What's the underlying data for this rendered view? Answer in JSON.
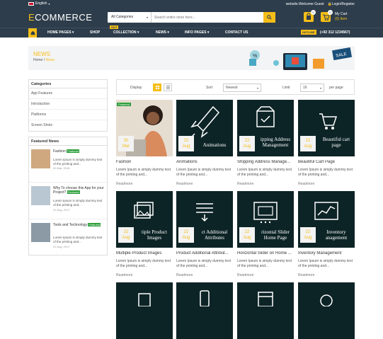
{
  "topbar": {
    "language": "English",
    "welcome": "website.Welcome Guest",
    "login": "Login/Register"
  },
  "header": {
    "logo_e": "E",
    "logo_rest": "COMMERCE",
    "search_category": "All Categories",
    "search_placeholder": "Search entire store here...",
    "wishlist_count": "0",
    "cart_count": "0",
    "cart_label": "My Cart",
    "cart_items": "(0) Item"
  },
  "nav": {
    "items": [
      "HOME PAGES",
      "SHOP",
      "COLLECTION",
      "NEWS",
      "INFO PAGES",
      "CONTACT US"
    ],
    "hot": "HOT",
    "hotline_label": "HOTLINE",
    "phone": "(+92 312 1234567)"
  },
  "banner": {
    "title": "NEWS",
    "crumb_home": "Home",
    "crumb_sep": "/",
    "crumb_current": "News",
    "sale": "SALE",
    "pct": "%"
  },
  "sidebar": {
    "categories_title": "Categories",
    "categories": [
      "App Features",
      "Introduction",
      "Platforms",
      "Screen Shots"
    ],
    "featured_title": "Featured News",
    "featured_badge": "Featured",
    "featured": [
      {
        "title": "Fashion",
        "desc": "Lorem Ipsum is simply dummy text of the printing and...",
        "date": "30 Mar, 2018"
      },
      {
        "title": "Why To choose this App for your Project?",
        "desc": "Lorem Ipsum is simply dummy text of the printing and...",
        "date": "22 Aug, 2017"
      },
      {
        "title": "Tools and Technology",
        "desc": "Lorem Ipsum is simply dummy text of the printing and...",
        "date": "22 Aug, 2017"
      }
    ]
  },
  "toolbar": {
    "display": "Display",
    "sort": "Sort",
    "sort_value": "Newest",
    "limit": "Limit",
    "limit_value": "16",
    "per_page": "per page"
  },
  "posts": [
    {
      "title": "Fashion",
      "day": "30",
      "month": "Mar",
      "featured": "Featured",
      "overlay": "",
      "desc": "Lorem Ipsum is simply dummy text of the printing and...",
      "readmore": "Readmore"
    },
    {
      "title": "Animations",
      "day": "22",
      "month": "Aug",
      "overlay": "Animations",
      "desc": "Lorem Ipsum is simply dummy text of the printing and...",
      "readmore": "Readmore"
    },
    {
      "title": "Shipping Address Manage...",
      "day": "22",
      "month": "Aug",
      "overlay": "ipping Address\nManagement",
      "desc": "Lorem Ipsum is simply dummy text of the printing and...",
      "readmore": "Readmore"
    },
    {
      "title": "Beautiful Cart Page",
      "day": "22",
      "month": "Aug",
      "overlay": "Beautiful cart\npage",
      "desc": "Lorem Ipsum is simply dummy text of the printing and...",
      "readmore": "Readmore"
    },
    {
      "title": "Multiple Product Images",
      "day": "22",
      "month": "Aug",
      "overlay": "tiple Product\nImages",
      "desc": "Lorem Ipsum is simply dummy text of the printing and...",
      "readmore": "Readmore"
    },
    {
      "title": "Product Additional Attribut...",
      "day": "22",
      "month": "Aug",
      "overlay": "ct Additional\nAttributes",
      "desc": "Lorem Ipsum is simply dummy text of the printing and...",
      "readmore": "Readmore"
    },
    {
      "title": "Horizontal Slider on Home ...",
      "day": "22",
      "month": "Aug",
      "overlay": "rizontal Slider\nHome Page",
      "desc": "Lorem Ipsum is simply dummy text of the printing and...",
      "readmore": "Readmore"
    },
    {
      "title": "Inventory Management",
      "day": "22",
      "month": "Aug",
      "overlay": "Inventory\nanagement",
      "desc": "Lorem Ipsum is simply dummy text of the printing and...",
      "readmore": "Readmore"
    },
    {
      "title": "",
      "day": "",
      "month": "",
      "overlay": "",
      "desc": "",
      "readmore": ""
    },
    {
      "title": "",
      "day": "",
      "month": "",
      "overlay": "",
      "desc": "",
      "readmore": ""
    },
    {
      "title": "",
      "day": "",
      "month": "",
      "overlay": "",
      "desc": "",
      "readmore": ""
    },
    {
      "title": "",
      "day": "",
      "month": "",
      "overlay": "",
      "desc": "",
      "readmore": ""
    }
  ],
  "colors": {
    "dark": "#2e3d4b",
    "accent": "#f6be18",
    "tile": "#0d2426",
    "featured": "#2b9e3a"
  }
}
